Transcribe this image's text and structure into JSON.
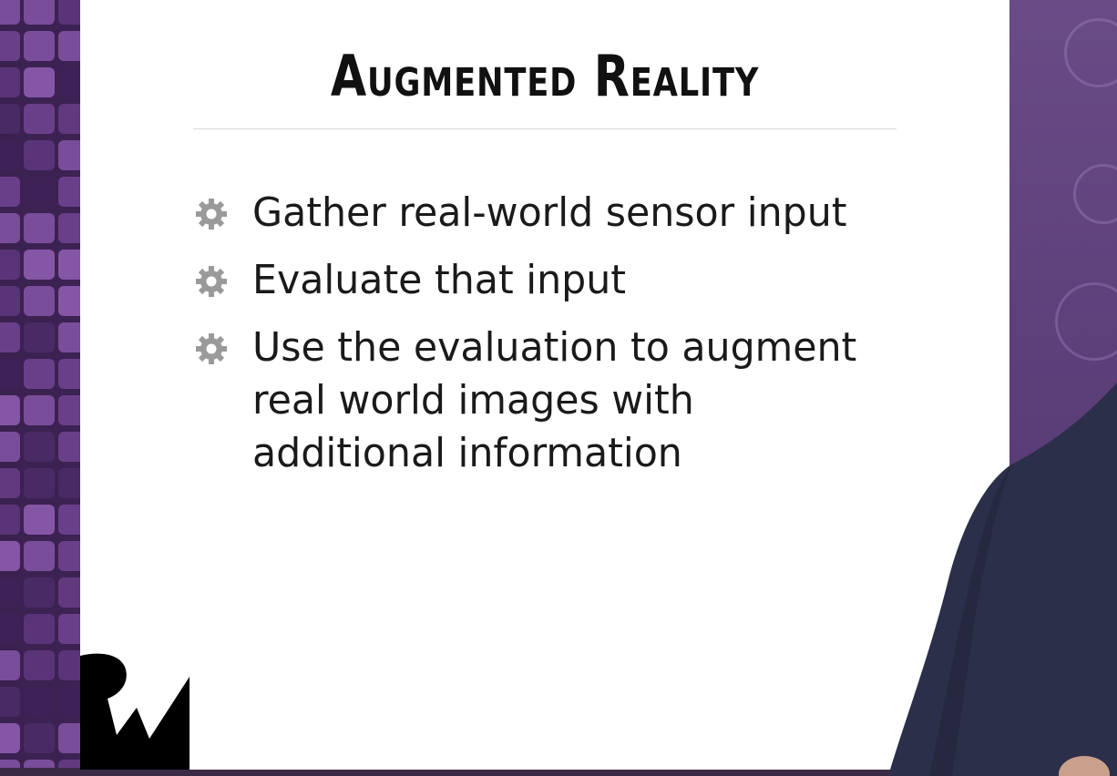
{
  "slide": {
    "title": "Augmented Reality",
    "bullets": [
      {
        "text": "Gather real-world sensor input",
        "icon": "gear-icon"
      },
      {
        "text": "Evaluate that input",
        "icon": "gear-icon"
      },
      {
        "text": "Use the evaluation to augment real world images with additional information",
        "icon": "gear-icon"
      }
    ],
    "logo": "rw-logo"
  },
  "colors": {
    "background_purple": "#4c2a68",
    "slide_bg": "#ffffff",
    "text": "#1a1a1a",
    "bullet_icon": "#9a9a9a",
    "shirt": "#2c2f4a"
  }
}
